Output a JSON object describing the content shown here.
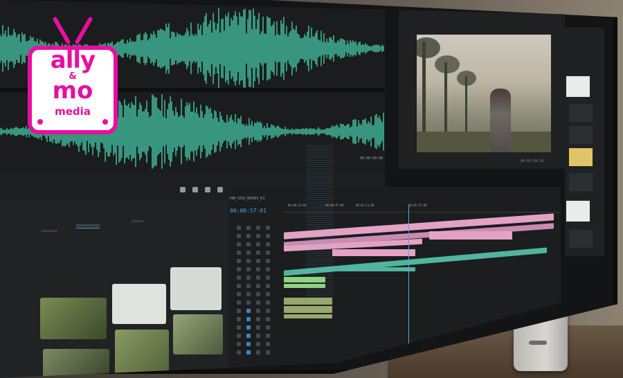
{
  "logo": {
    "line1": "ally",
    "line2": "&",
    "line3": "mo",
    "line4": "media",
    "color": "#e60fa0"
  },
  "waveform": {
    "color": "#46c6a5",
    "timecode": "00:00:00:00"
  },
  "program_monitor": {
    "timecode": "00:03:58:18"
  },
  "timeline": {
    "timecode": "00:00:57:01",
    "sequence_tab": "HBI_GOU_BASES_R1",
    "ruler_labels": [
      "00:00:23:00",
      "00:00:47:00",
      "00:01:11:00",
      "00:01:35:00"
    ]
  },
  "colors": {
    "video_clip": "#e3a2c4",
    "audio_clip": "#4fb59f",
    "accent_blue": "#5aa6d6"
  }
}
